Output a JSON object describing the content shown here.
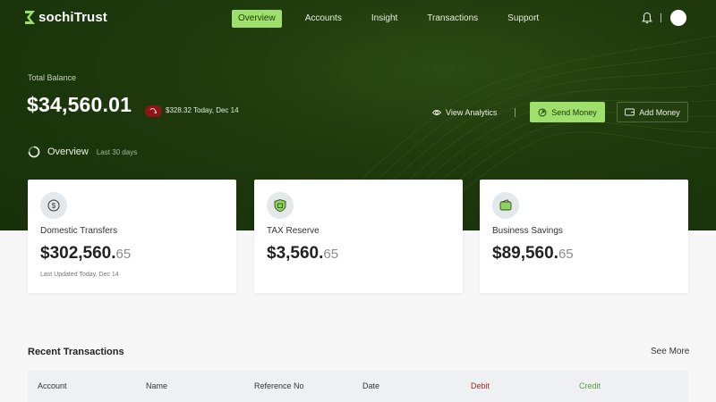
{
  "brand": {
    "name_prefix": "sochi",
    "name_suffix": "Trust",
    "accent_color": "#9ee06b",
    "hero_color": "#1f3a0c"
  },
  "nav": {
    "items": [
      {
        "label": "Overview",
        "active": true
      },
      {
        "label": "Accounts",
        "active": false
      },
      {
        "label": "Insight",
        "active": false
      },
      {
        "label": "Transactions",
        "active": false
      },
      {
        "label": "Support",
        "active": false
      }
    ],
    "icons": [
      "bell-icon",
      "avatar"
    ]
  },
  "balance": {
    "label": "Total Balance",
    "amount": "$34,560.01",
    "change_text": "$328.32 Today, Dec 14",
    "change_color": "#8c1616"
  },
  "actions": {
    "view_analytics": "View Analytics",
    "send_money": "Send Money",
    "add_money": "Add Money"
  },
  "overview": {
    "title": "Overview",
    "subtitle": "Last 30 days"
  },
  "cards": [
    {
      "title": "Domestic Transfers",
      "amount": "$302,560.",
      "cents": "65",
      "updated": "Last Updated Today, Dec 14",
      "icon": "dollar-coin-icon"
    },
    {
      "title": "TAX Reserve",
      "amount": "$3,560.",
      "cents": "65",
      "updated": "",
      "icon": "shield-icon"
    },
    {
      "title": "Business Savings",
      "amount": "$89,560.",
      "cents": "65",
      "updated": "",
      "icon": "wallet-icon"
    }
  ],
  "transactions": {
    "title": "Recent Transactions",
    "see_more": "See More",
    "columns": [
      "Account",
      "Name",
      "Reference No",
      "Date",
      "Debit",
      "Credit"
    ],
    "debit_color": "#9c2a2a",
    "credit_color": "#5d9a36"
  }
}
